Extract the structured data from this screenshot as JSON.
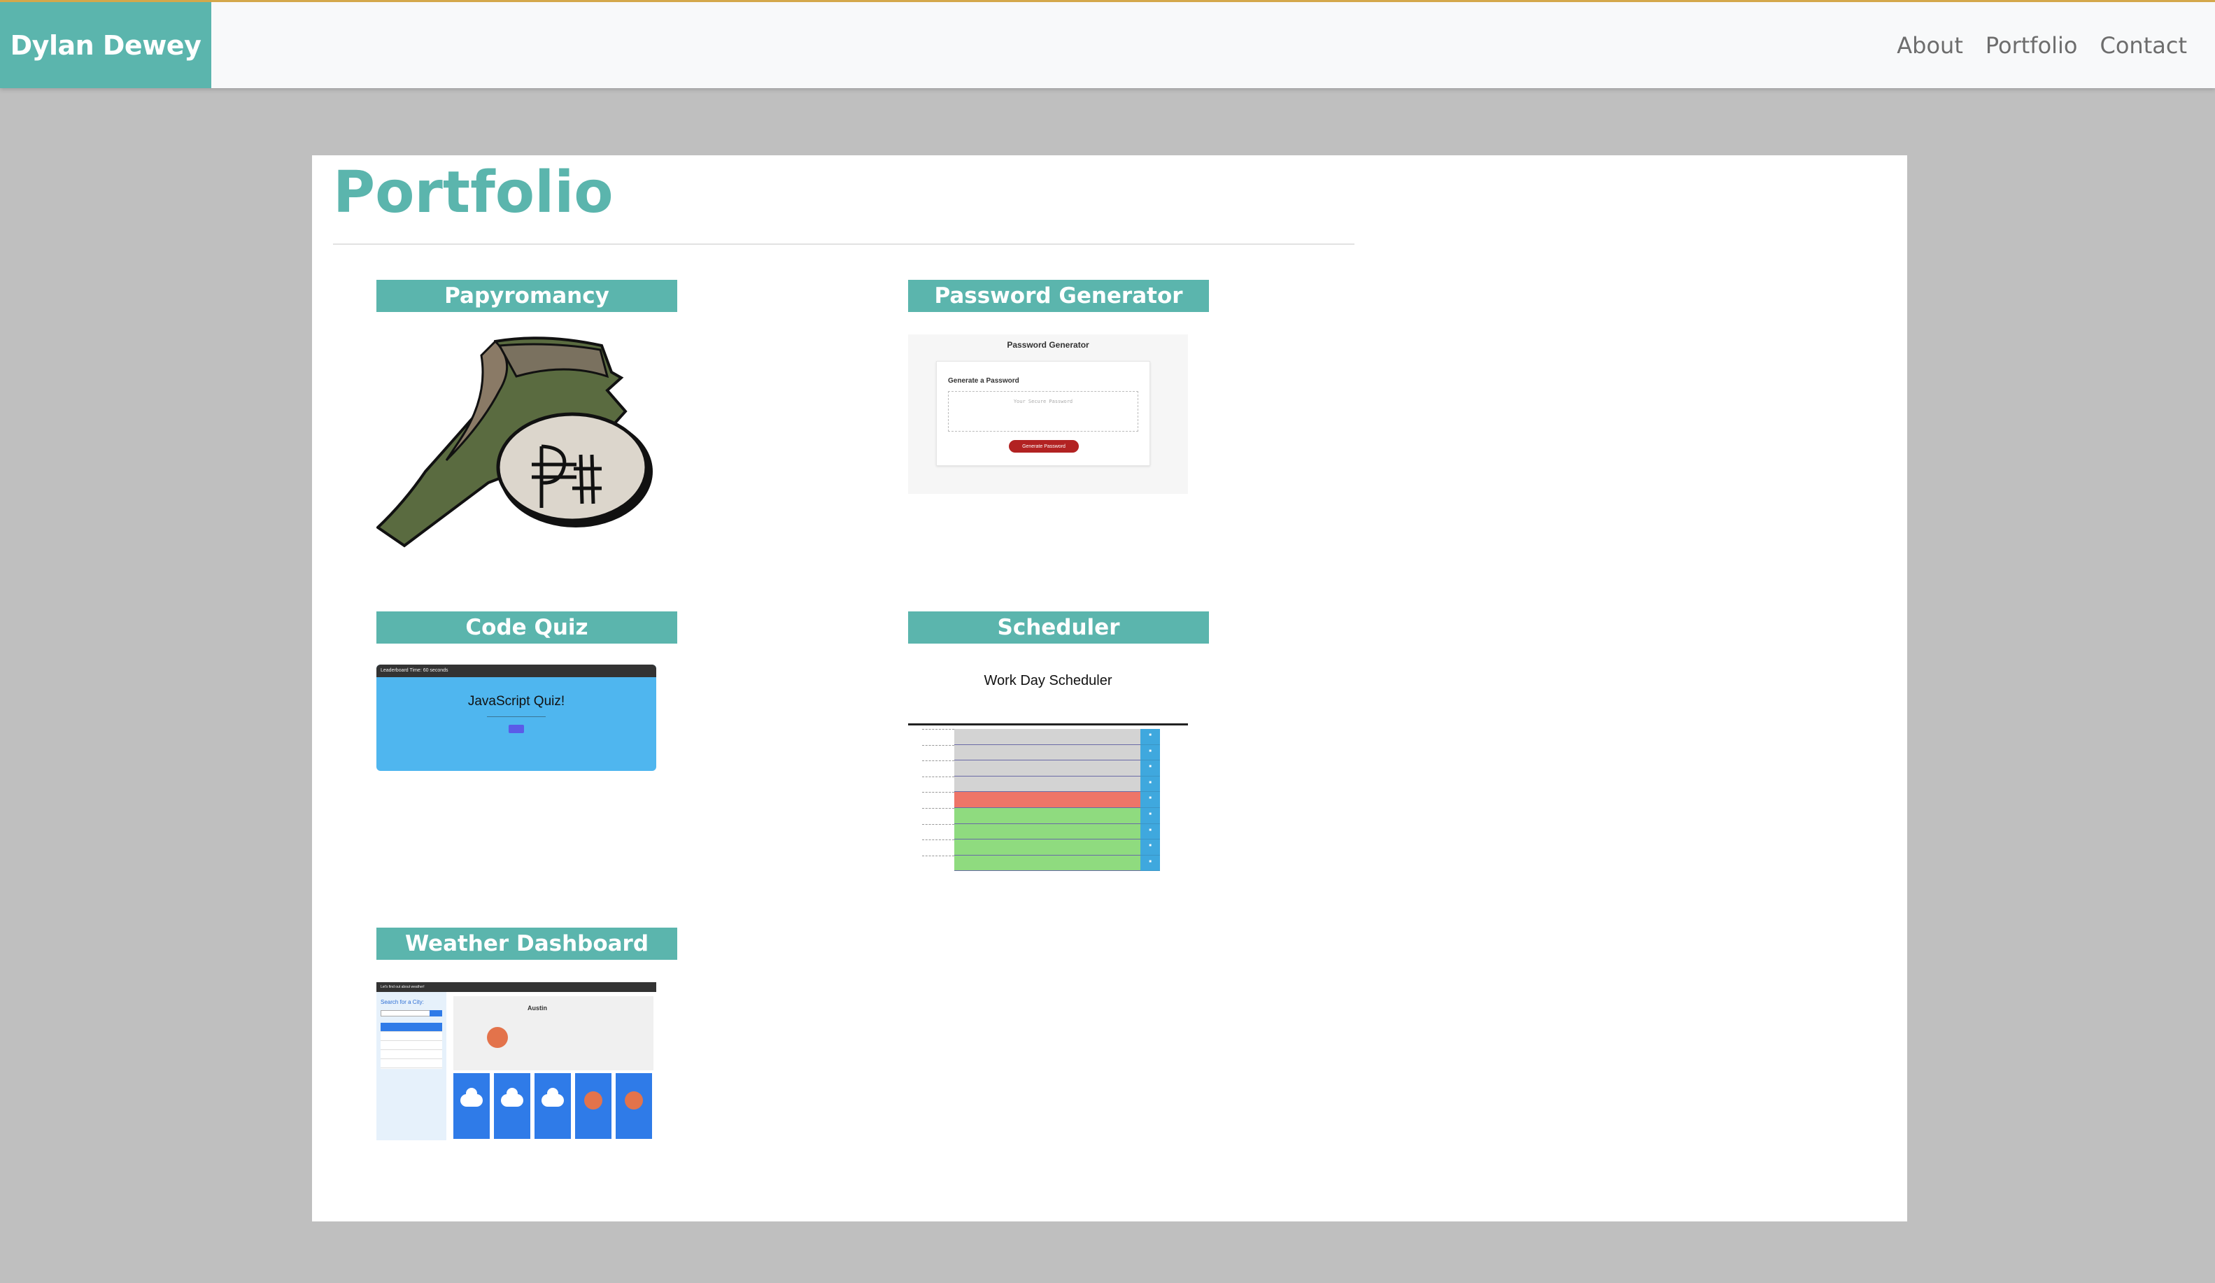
{
  "brand": "Dylan Dewey",
  "nav": {
    "about": "About",
    "portfolio": "Portfolio",
    "contact": "Contact"
  },
  "page": {
    "title": "Portfolio"
  },
  "projects": [
    {
      "title": "Papyromancy"
    },
    {
      "title": "Password Generator"
    },
    {
      "title": "Code Quiz"
    },
    {
      "title": "Scheduler"
    },
    {
      "title": "Weather Dashboard"
    }
  ],
  "thumbs": {
    "password": {
      "heading": "Password Generator",
      "subheading": "Generate a Password",
      "placeholder": "Your Secure Password",
      "button": "Generate Password"
    },
    "quiz": {
      "bar": "Leaderboard     Time: 60 seconds",
      "title": "JavaScript Quiz!"
    },
    "scheduler": {
      "title": "Work Day Scheduler"
    },
    "weather": {
      "bar": "Let's find out about weather!",
      "search": "Search for a City:",
      "city": "Austin"
    }
  },
  "colors": {
    "accent": "#5bb5ad",
    "background": "#bfbfbf",
    "nav_background": "#f8f9fa"
  }
}
